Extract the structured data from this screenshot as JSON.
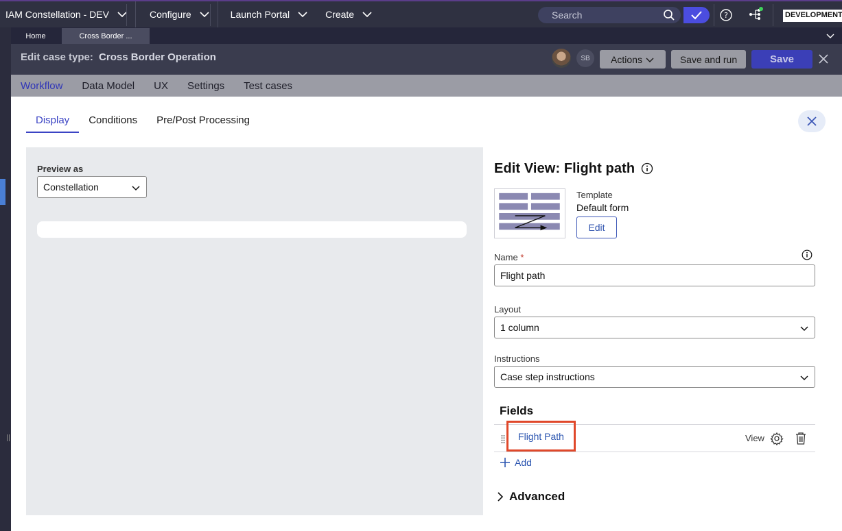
{
  "topbar": {
    "app_name": "IAM Constellation - DEV",
    "menus": [
      "Configure",
      "Launch Portal",
      "Create"
    ],
    "search_placeholder": "Search",
    "environment": "DEVELOPMENT"
  },
  "doc_tabs": {
    "home": "Home",
    "active": "Cross Border ..."
  },
  "header": {
    "label": "Edit case type:",
    "case_name": "Cross Border Operation",
    "avatar_initials": "SB",
    "actions_label": "Actions",
    "save_run_label": "Save and run",
    "save_label": "Save"
  },
  "subnav": {
    "items": [
      "Workflow",
      "Data Model",
      "UX",
      "Settings",
      "Test cases"
    ],
    "active": "Workflow"
  },
  "tabs": {
    "items": [
      "Display",
      "Conditions",
      "Pre/Post Processing"
    ],
    "active": "Display"
  },
  "preview": {
    "label": "Preview as",
    "value": "Constellation"
  },
  "edit_view": {
    "title": "Edit View: Flight path",
    "template_label": "Template",
    "template_value": "Default form",
    "edit_label": "Edit",
    "name_label": "Name",
    "name_required": "*",
    "name_value": "Flight path",
    "layout_label": "Layout",
    "layout_value": "1 column",
    "instructions_label": "Instructions",
    "instructions_value": "Case step instructions",
    "fields_title": "Fields",
    "field_name": "Flight Path",
    "field_mode": "View",
    "add_label": "Add",
    "advanced_label": "Advanced"
  },
  "colors": {
    "accent": "#3b44c4",
    "save": "#3b3fb7",
    "highlight": "#e0482a",
    "link": "#2b55b0"
  },
  "icons": [
    "search-icon",
    "check-icon",
    "help-icon",
    "tree-icon",
    "close-icon",
    "info-icon",
    "gear-icon",
    "trash-icon",
    "plus-icon",
    "chevron-right-icon",
    "drag-handle-icon"
  ]
}
